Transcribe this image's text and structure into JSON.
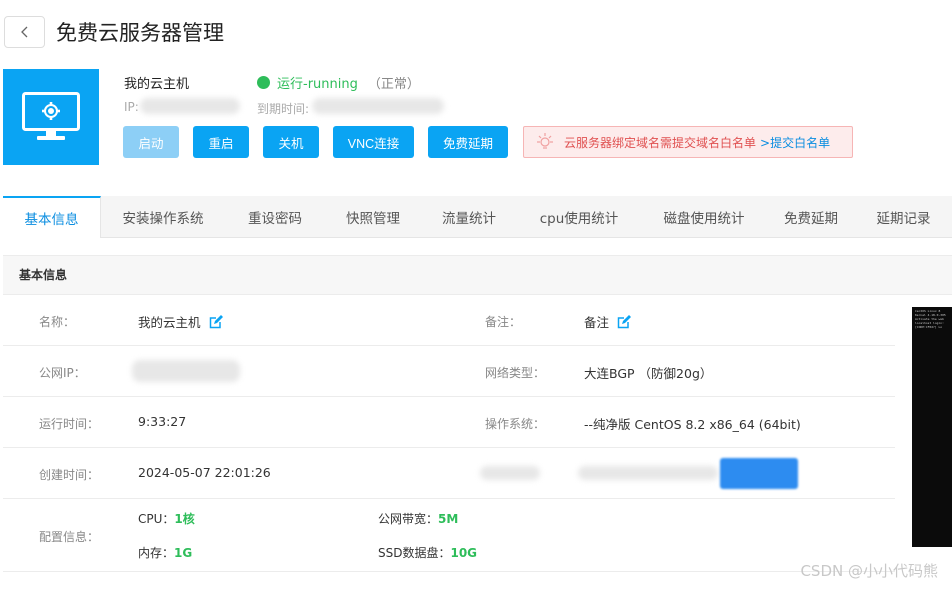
{
  "header": {
    "title": "免费云服务器管理"
  },
  "server": {
    "name": "我的云主机",
    "status": "运行-running",
    "status_note": "（正常）",
    "ip_label": "IP:",
    "expire_label": "到期时间:"
  },
  "actions": {
    "start": "启动",
    "restart": "重启",
    "shutdown": "关机",
    "vnc": "VNC连接",
    "extend": "免费延期"
  },
  "notice": {
    "text": "云服务器绑定域名需提交域名白名单",
    "link": ">提交白名单"
  },
  "tabs": [
    "基本信息",
    "安装操作系统",
    "重设密码",
    "快照管理",
    "流量统计",
    "cpu使用统计",
    "磁盘使用统计",
    "免费延期",
    "延期记录"
  ],
  "section": {
    "title": "基本信息"
  },
  "info": {
    "name_label": "名称：",
    "name_value": "我的云主机",
    "remark_label": "备注：",
    "remark_value": "备注",
    "public_ip_label": "公网IP：",
    "network_label": "网络类型：",
    "network_value": "大连BGP （防御20g）",
    "uptime_label": "运行时间：",
    "uptime_value": "9:33:27",
    "os_label": "操作系统：",
    "os_value": "--纯净版 CentOS 8.2 x86_64 (64bit)",
    "created_label": "创建时间：",
    "created_value": "2024-05-07 22:01:26",
    "config_label": "配置信息：",
    "cpu_label": "CPU：",
    "cpu_value": "1核",
    "bandwidth_label": "公网带宽：",
    "bandwidth_value": "5M",
    "memory_label": "内存：",
    "memory_value": "1G",
    "disk_label": "SSD数据盘：",
    "disk_value": "10G"
  },
  "terminal_lines": [
    "CentOS Linux 8",
    "Kernel 4.18.0-305",
    "",
    "Activate the web",
    "",
    "localhost login:",
    "[CODE:CF02?] Lo"
  ],
  "watermark": "CSDN @小小代码熊",
  "colors": {
    "accent": "#0aa4f3",
    "running": "#2ebd5a",
    "notice_text": "#e05050",
    "link": "#0a8de0"
  }
}
